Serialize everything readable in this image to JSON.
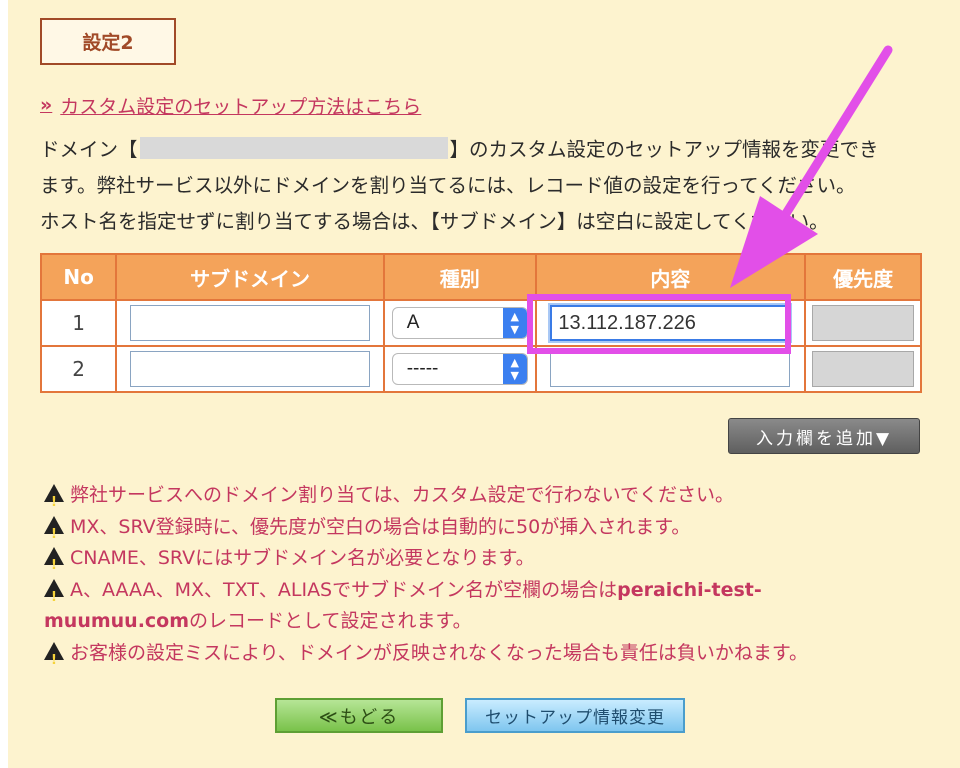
{
  "section_title": "設定2",
  "howto_link": {
    "prefix": "»",
    "text": "カスタム設定のセットアップ方法はこちら"
  },
  "description": {
    "line1_before": "ドメイン【",
    "line1_after": "】のカスタム設定のセットアップ情報を変更でき",
    "line2": "ます。弊社サービス以外にドメインを割り当てるには、レコード値の設定を行ってください。",
    "line3": "ホスト名を指定せずに割り当てする場合は、【サブドメイン】は空白に設定してください。"
  },
  "table": {
    "headers": {
      "no": "No",
      "subdomain": "サブドメイン",
      "type": "種別",
      "content": "内容",
      "priority": "優先度"
    },
    "rows": [
      {
        "no": "1",
        "subdomain": "",
        "type": "A",
        "content": "13.112.187.226",
        "priority": ""
      },
      {
        "no": "2",
        "subdomain": "",
        "type": "-----",
        "content": "",
        "priority": ""
      }
    ]
  },
  "add_button": "入力欄を追加▼",
  "notes": {
    "n1": "弊社サービスへのドメイン割り当ては、カスタム設定で行わないでください。",
    "n2": "MX、SRV登録時に、優先度が空白の場合は自動的に50が挿入されます。",
    "n3": "CNAME、SRVにはサブドメイン名が必要となります。",
    "n4_a": "A、AAAA、MX、TXT、ALIASでサブドメイン名が空欄の場合は",
    "n4_domain1": "peraichi-test-",
    "n4_domain2": "muumuu.com",
    "n4_b": "のレコードとして設定されます。",
    "n5": "お客様の設定ミスにより、ドメインが反映されなくなった場合も責任は負いかねます。"
  },
  "buttons": {
    "back": "≪もどる",
    "submit": "セットアップ情報変更"
  },
  "colors": {
    "background": "#fdf3cf",
    "table_header": "#f4a35a",
    "table_border": "#e3763b",
    "link": "#c4375f",
    "annotation": "#e24fe8",
    "title_border": "#a14a28"
  },
  "icons": {
    "warning": "warning-icon",
    "select_arrow": "chevron-updown-icon"
  }
}
